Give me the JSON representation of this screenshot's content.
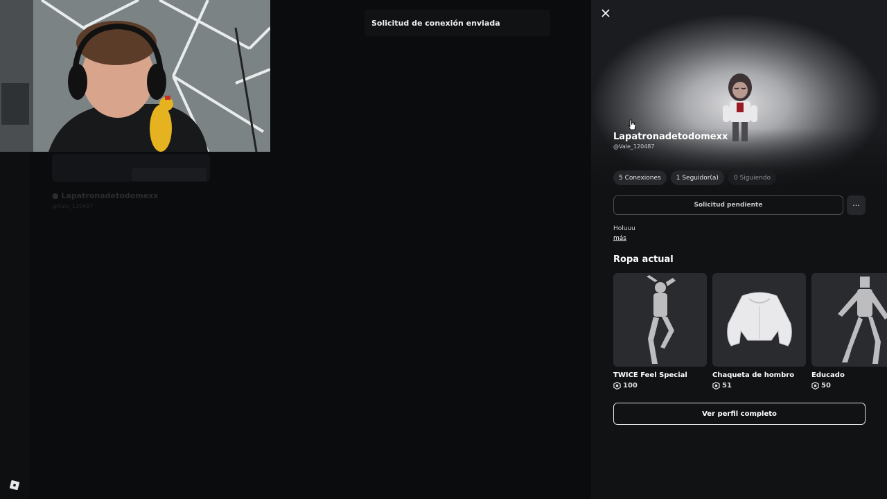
{
  "toast": {
    "message": "Solicitud de conexión enviada"
  },
  "background_page": {
    "display_name": "● Lapatronadetodomexx",
    "handle": "@Vale_120487"
  },
  "profile": {
    "display_name": "Lapatronadetodomexx",
    "handle": "@Vale_120487",
    "stats": {
      "connections": "5 Conexiones",
      "followers": "1 Seguidor(a)",
      "following": "0 Siguiendo"
    },
    "pending_button": "Solicitud pendiente",
    "more_button": "···",
    "bio": "Holuuu",
    "more_link": "más",
    "outfit_title": "Ropa actual",
    "items": [
      {
        "name": "TWICE Feel Special",
        "price": "100",
        "icon": "emote-pose-thumbnail"
      },
      {
        "name": "Chaqueta de hombro",
        "price": "51",
        "icon": "jacket-thumbnail"
      },
      {
        "name": "Educado",
        "price": "50",
        "icon": "animation-pose-thumbnail"
      }
    ],
    "full_profile_button": "Ver perfil completo"
  },
  "icons": {
    "close": "close-icon",
    "robux": "robux-icon",
    "logo": "roblox-logo-icon"
  }
}
